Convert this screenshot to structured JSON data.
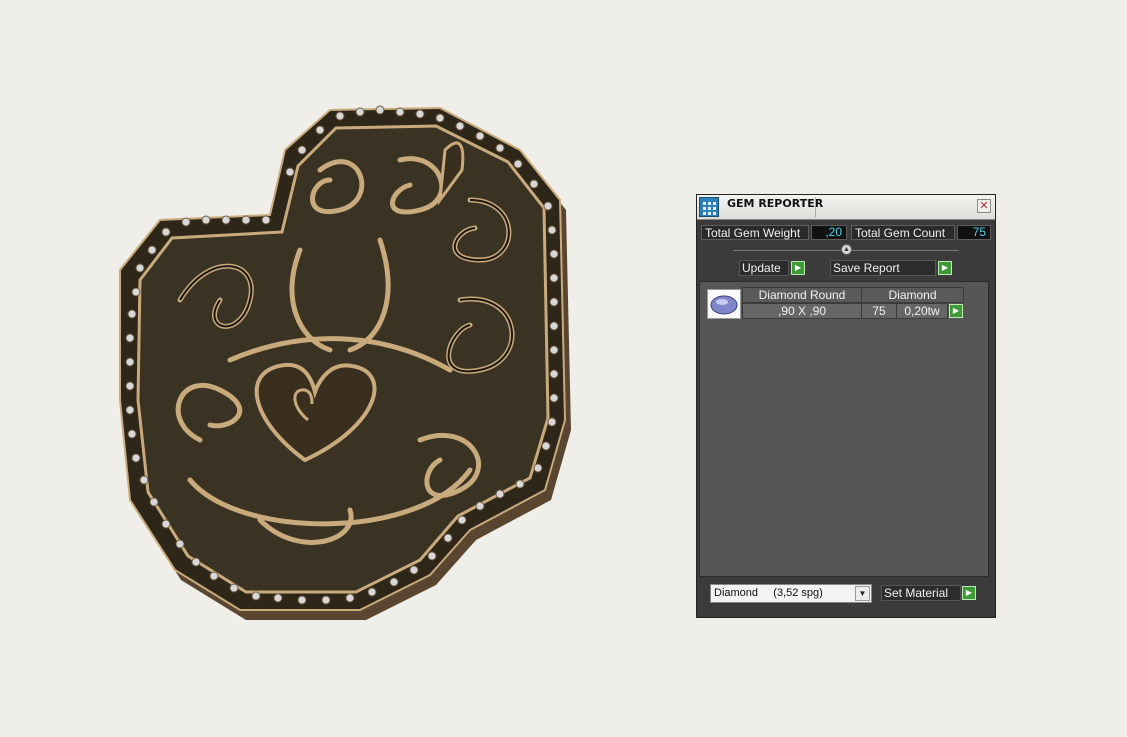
{
  "panel": {
    "title": "GEM REPORTER",
    "close_glyph": "✕",
    "totals": {
      "weight_label": "Total Gem Weight",
      "weight_value": ",20",
      "count_label": "Total Gem Count",
      "count_value": "75"
    },
    "splitter_glyph": "▲",
    "buttons": {
      "update_label": "Update",
      "save_report_label": "Save Report",
      "set_material_label": "Set Material",
      "go_glyph": "▶"
    },
    "gem_row": {
      "shape": "Diamond Round",
      "material": "Diamond",
      "size": ",90 X ,90",
      "count": "75",
      "weight": "0,20tw"
    },
    "material_select": {
      "selected": "Diamond     (3,52 spg)",
      "arrow_glyph": "▼"
    }
  },
  "icons": {
    "app": "grid-app-icon",
    "close": "close-icon",
    "gem": "diamond-gem-icon",
    "go": "play-arrow-icon",
    "dropdown": "chevron-down-icon"
  },
  "colors": {
    "background": "#efeee8",
    "panel": "#3b3b3b",
    "value_text": "#4fd5e8",
    "go_button": "#3c9b35",
    "metal_dark": "#3a3222",
    "metal_gold": "#c9aa7d"
  }
}
